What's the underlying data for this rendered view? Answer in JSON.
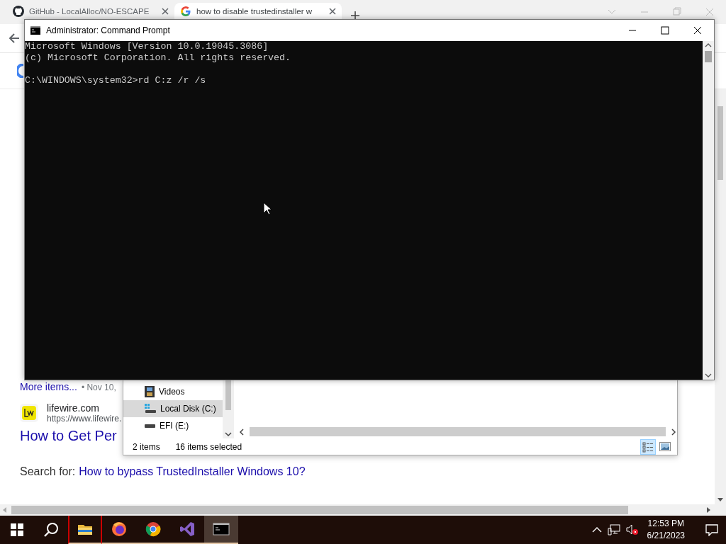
{
  "browser": {
    "tabs": [
      {
        "title": "GitHub - LocalAlloc/NO-ESCAPE",
        "selected": false,
        "kind": "github"
      },
      {
        "title": "how to disable trustedinstaller w",
        "selected": true,
        "kind": "google"
      }
    ],
    "page": {
      "more_items": "More items...",
      "date": "• Nov 10,",
      "site_name": "lifewire.com",
      "site_url": "https://www.lifewire.",
      "result_title": "How to Get Per",
      "search_for_label": "Search for:",
      "search_for_link": "How to bypass TrustedInstaller Windows 10?"
    }
  },
  "explorer": {
    "nav_items": [
      {
        "label": "Videos",
        "selected": false,
        "kind": "videos"
      },
      {
        "label": "Local Disk (C:)",
        "selected": true,
        "kind": "system-drive"
      },
      {
        "label": "EFI (E:)",
        "selected": false,
        "kind": "drive"
      }
    ],
    "status_count": "2 items",
    "status_selected": "16 items selected",
    "views": [
      {
        "kind": "details",
        "selected": true
      },
      {
        "kind": "large-icons",
        "selected": false
      }
    ]
  },
  "cmd": {
    "title": "Administrator:  Command Prompt",
    "lines": [
      {
        "text": "Microsoft Windows [Version 10.0.19045.3086]",
        "gap_before": false
      },
      {
        "text": "(c) Microsoft Corporation. All rights reserved.",
        "gap_before": false
      },
      {
        "text": "C:\\WINDOWS\\system32>rd C:z /r /s",
        "gap_before": true
      }
    ]
  },
  "taskbar": {
    "apps": [
      {
        "kind": "explorer",
        "running": true,
        "selected": false
      },
      {
        "kind": "firefox",
        "running": true,
        "selected": false
      },
      {
        "kind": "chrome",
        "running": true,
        "selected": false
      },
      {
        "kind": "visual-studio",
        "running": true,
        "selected": false
      },
      {
        "kind": "terminal",
        "running": true,
        "selected": true
      }
    ],
    "time": "12:53 PM",
    "date": "6/21/2023"
  }
}
